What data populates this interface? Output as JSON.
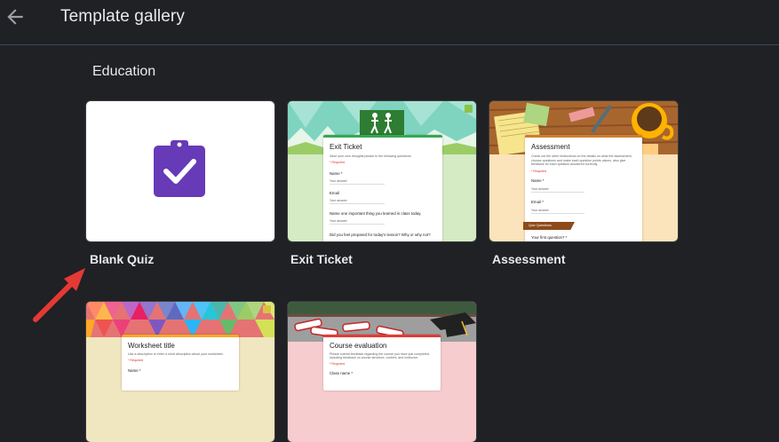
{
  "header": {
    "title": "Template gallery",
    "back_icon": "arrow-back-icon"
  },
  "section": {
    "title": "Education"
  },
  "templates": [
    {
      "label": "Blank Quiz",
      "icon": "quiz-clipboard-check-icon",
      "icon_color": "#673ab7"
    },
    {
      "label": "Exit Ticket",
      "form_title": "Exit Ticket",
      "form_desc": "Save your own thoughts please to the following questions.",
      "required": "* Required",
      "q1": "Name *",
      "q2": "Email",
      "q3": "Name one important thing you learned in class today.",
      "q4": "Did you feel prepared for today's lesson? Why or why not?",
      "answer_placeholder": "Your answer",
      "accent": "#34a853"
    },
    {
      "label": "Assessment",
      "form_title": "Assessment",
      "form_desc": "Check out the other instructions on the details on what the assessment, choose questions and make each question points values, also give feedback for each question answered correctly.",
      "required": "* Required",
      "q1": "Name *",
      "q2": "Email *",
      "section_label": "Quiz Questions",
      "q3": "Your first question? *",
      "answer_placeholder": "Your answer",
      "accent": "#d07f2c"
    },
    {
      "label": "",
      "form_title": "Worksheet title",
      "form_desc": "Use a description to enter a short description about your worksheet.",
      "required": "* Required",
      "q1": "Name *"
    },
    {
      "label": "",
      "form_title": "Course evaluation",
      "form_desc": "Please submit feedback regarding the course you have just completed, including feedback on course structure, content, and instructor.",
      "required": "* Required",
      "q1": "Class name *",
      "accent": "#e53935"
    }
  ],
  "annotation": {
    "arrow_color": "#e53935"
  }
}
